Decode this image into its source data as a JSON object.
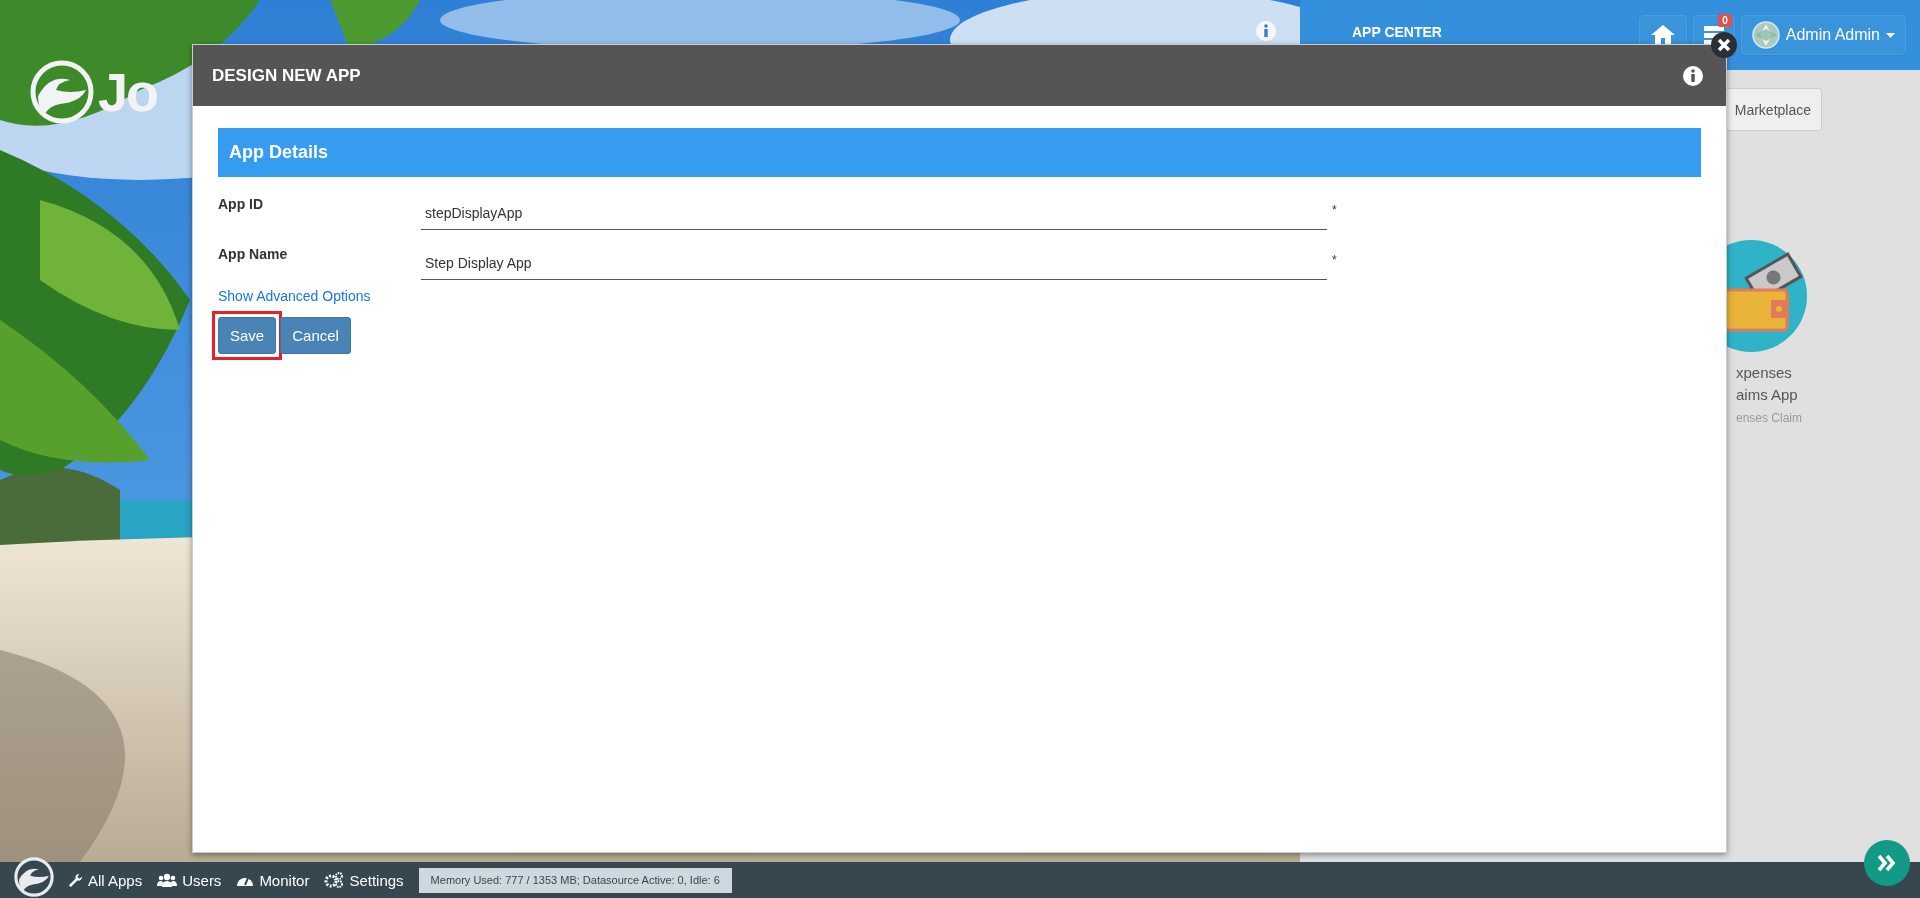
{
  "background": {
    "kind": "picture",
    "logo_text": "Jo"
  },
  "header": {
    "title": "APP CENTER",
    "notification_count": "0",
    "user_name": "Admin Admin"
  },
  "marketplace_button": "Marketplace",
  "app_card": {
    "name_lines": [
      "xpenses",
      "aims App"
    ],
    "description": "enses Claim"
  },
  "dialog": {
    "title": "DESIGN NEW APP",
    "section": "App Details",
    "fields": [
      {
        "label": "App ID",
        "value": "stepDisplayApp",
        "required_mark": "*"
      },
      {
        "label": "App Name",
        "value": "Step Display App",
        "required_mark": "*"
      }
    ],
    "advanced_link": "Show Advanced Options",
    "buttons": [
      {
        "label": "Save",
        "highlighted": true
      },
      {
        "label": "Cancel",
        "highlighted": false
      }
    ]
  },
  "taskbar": {
    "items": [
      "All Apps",
      "Users",
      "Monitor",
      "Settings"
    ],
    "status": "Memory Used: 777 / 1353 MB; Datasource Active: 0, Idle: 6"
  }
}
